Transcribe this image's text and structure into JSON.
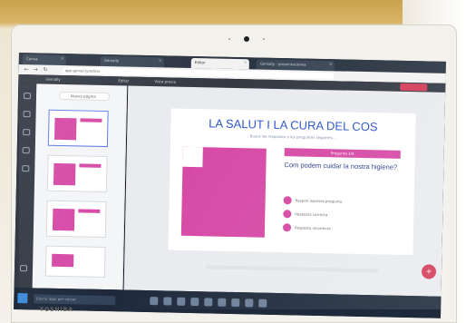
{
  "browser": {
    "tabs": [
      "Canva",
      "Genially",
      "Editar",
      "Genially - presentaciones"
    ],
    "url": "app.genial.ly/editor"
  },
  "app": {
    "top_items": [
      "Genially",
      "Editar",
      "Vista previa"
    ],
    "new_slide_label": "Nueva página"
  },
  "slide": {
    "title": "LA SALUT I LA CURA DEL COS",
    "subtitle": "Busca les respostes a les preguntes seguents...",
    "badge": "Pregunta 1/4",
    "question": "Com podem cuidar la nostra higiene?",
    "options": [
      "Respon aquesta pregunta",
      "Resposta correcta",
      "Resposta incorrecta"
    ]
  },
  "taskbar": {
    "search_placeholder": "Escriu aquí per cercar"
  },
  "brand": "TOSHIBA"
}
